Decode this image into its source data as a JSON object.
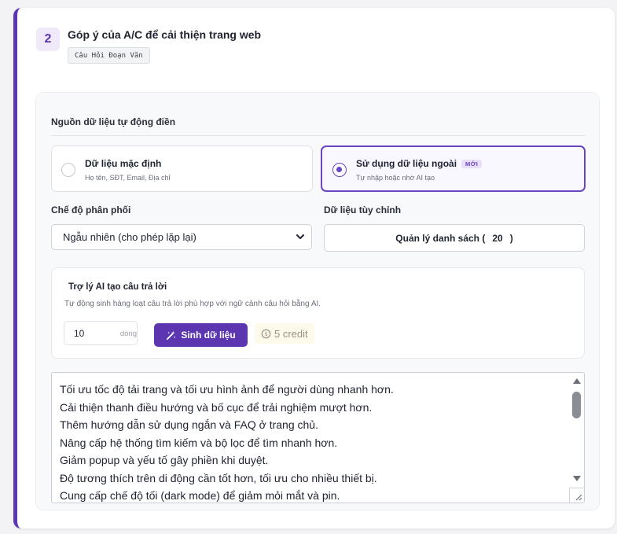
{
  "question": {
    "number": "2",
    "title": "Góp ý của A/C để cải thiện trang web",
    "type_badge": "Câu Hỏi Đoạn Văn"
  },
  "data_source": {
    "label": "Nguồn dữ liệu tự động điền",
    "options": [
      {
        "title": "Dữ liệu mặc định",
        "subtitle": "Họ tên, SĐT, Email, Địa chỉ",
        "selected": false
      },
      {
        "title": "Sử dụng dữ liệu ngoài",
        "badge": "MỚI",
        "subtitle": "Tự nhập hoặc nhờ AI tạo",
        "selected": true
      }
    ]
  },
  "distribution": {
    "label": "Chế độ phân phối",
    "selected": "Ngẫu nhiên (cho phép lặp lại)"
  },
  "custom_data": {
    "label": "Dữ liệu tùy chỉnh",
    "button_label": "Quản lý danh sách (",
    "count": "20",
    "button_suffix": ")"
  },
  "ai": {
    "title": "Trợ lý AI tạo câu trả lời",
    "description": "Tự động sinh hàng loạt câu trả lời phù hợp với ngữ cảnh câu hỏi bằng AI.",
    "count_value": "10",
    "count_unit": "dòng",
    "generate_label": "Sinh dữ liệu",
    "credit_label": "5 credit"
  },
  "answers": [
    "Tối ưu tốc độ tải trang và tối ưu hình ảnh để người dùng nhanh hơn.",
    "Cải thiện thanh điều hướng và bố cục để trải nghiệm mượt hơn.",
    "Thêm hướng dẫn sử dụng ngắn và FAQ ở trang chủ.",
    "Nâng cấp hệ thống tìm kiếm và bộ lọc để tìm nhanh hơn.",
    "Giảm popup và yếu tố gây phiền khi duyệt.",
    "Độ tương thích trên di động cần tốt hơn, tối ưu cho nhiều thiết bị.",
    "Cung cấp chế độ tối (dark mode) để giảm mỏi mắt và pin."
  ],
  "colors": {
    "accent": "#5b36b0",
    "accent_light": "#efe9fa",
    "badge_bg": "#e8ddfb"
  }
}
